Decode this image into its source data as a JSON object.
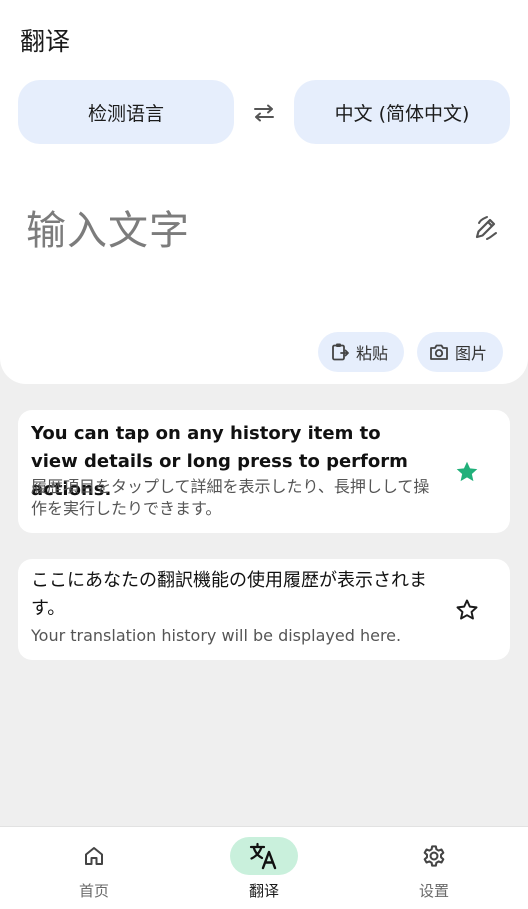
{
  "app": {
    "title": "翻译"
  },
  "language": {
    "source": "检测语言",
    "target": "中文 (简体中文)",
    "swap_icon": "swap-arrows-icon"
  },
  "input": {
    "placeholder": "输入文字",
    "handwrite_icon": "pen-icon"
  },
  "actions": {
    "paste_label": "粘贴",
    "image_label": "图片"
  },
  "history": [
    {
      "primary": "You can tap on any history item to view details or long press to perform actions.",
      "secondary": "履歴項目をタップして詳細を表示したり、長押しして操作を実行したりできます。",
      "starred": true
    },
    {
      "primary": "ここにあなたの翻訳機能の使用履歴が表示されます。",
      "secondary": "Your translation history will be displayed here.",
      "starred": false
    }
  ],
  "nav": {
    "items": [
      {
        "label": "首页",
        "icon": "home-icon"
      },
      {
        "label": "翻译",
        "icon": "translate-icon",
        "active": true
      },
      {
        "label": "设置",
        "icon": "gear-icon"
      }
    ]
  },
  "colors": {
    "accent_green": "#21b07a",
    "chip_bg": "#e6eefc",
    "nav_active_bg": "#c9f0dc"
  }
}
